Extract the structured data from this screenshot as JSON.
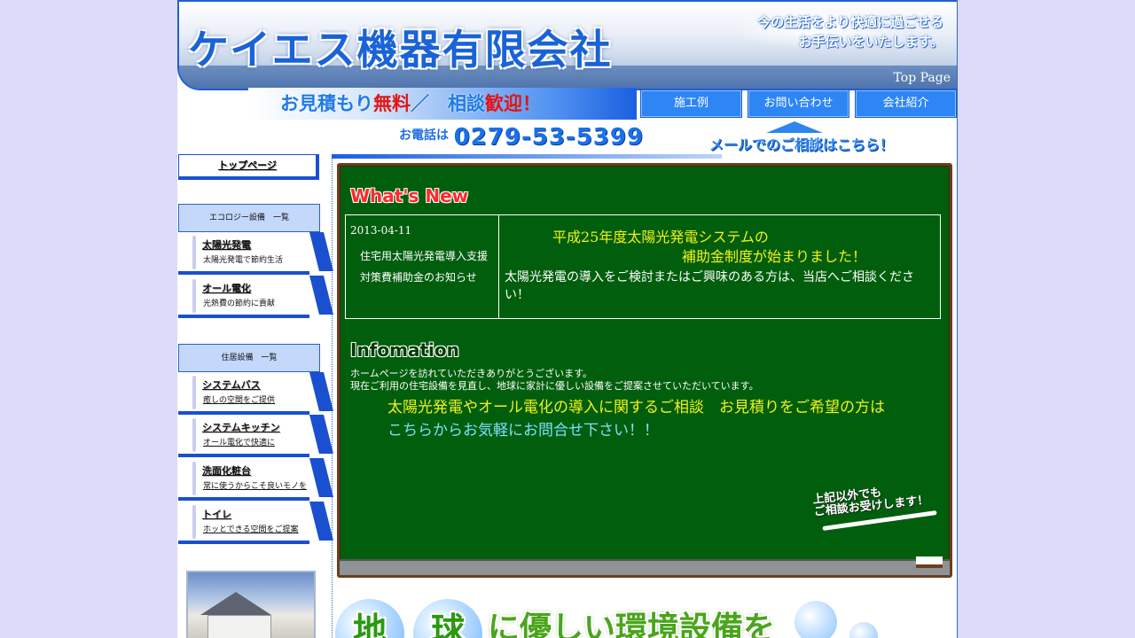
{
  "header": {
    "company_name": "ケイエス機器有限会社",
    "tagline_line1": "今の生活をより快適に過ごせる",
    "tagline_line2": "お手伝いをいたします。",
    "top_page_link": "Top Page"
  },
  "slogan": {
    "part1": "お見積もり",
    "part2": "無料",
    "part3": "／　相談",
    "part4": "歓迎！"
  },
  "nav": [
    {
      "label": "施工例"
    },
    {
      "label": "お問い合わせ"
    },
    {
      "label": "会社紹介"
    }
  ],
  "contact": {
    "phone_label": "お電話は",
    "phone_number": "0279-53-5399",
    "mail_text": "メールでのご相談はこちら！"
  },
  "sidebar": {
    "top_link": "トップページ",
    "eco_header": "エコロジー設備　一覧",
    "eco_items": [
      {
        "title": "太陽光発電",
        "subtitle": "太陽光発電で節約生活"
      },
      {
        "title": "オール電化",
        "subtitle": "光熱費の節約に貢献"
      }
    ],
    "home_header": "住居設備　一覧",
    "home_items": [
      {
        "title": "システムバス",
        "subtitle": "癒しの空間をご提供"
      },
      {
        "title": "システムキッチン",
        "subtitle": "オール電化で快適に"
      },
      {
        "title": "洗面化粧台",
        "subtitle": "常に使うからこそ良いモノを"
      },
      {
        "title": "トイレ",
        "subtitle": "ホッとできる空間をご提案"
      }
    ]
  },
  "board": {
    "whats_new_heading": "What's New",
    "news": {
      "date": "2013-04-11",
      "title": "住宅用太陽光発電導入支援対策費補助金のお知らせ",
      "headline_line1": "平成25年度太陽光発電システムの",
      "headline_line2": "補助金制度が始まりました！",
      "body": "太陽光発電の導入をご検討またはご興味のある方は、当店へご相談ください！"
    },
    "info_heading": "Infomation",
    "info_line1": "ホームページを訪れていただきありがとうございます。",
    "info_line2": "現在ご利用の住宅設備を見直し、地球に家計に優しい設備をご提案させていただいています。",
    "cta_line1": "太陽光発電やオール電化の導入に関するご相談　お見積りをご希望の方は",
    "cta_line2": "こちらからお気軽にお問合せ下さい！！",
    "other_consult_line1": "上記以外でも",
    "other_consult_line2": "ご相談お受けします！"
  },
  "eco_banner": {
    "globe1": "地",
    "globe2": "球",
    "text": "に優しい環境設備を"
  },
  "colors": {
    "page_background": "#dcdaf8",
    "accent_blue": "#1f5fd6",
    "nav_button": "#2e86f5",
    "board_green": "#005e0c",
    "headline_yellow": "#f1f21a"
  }
}
